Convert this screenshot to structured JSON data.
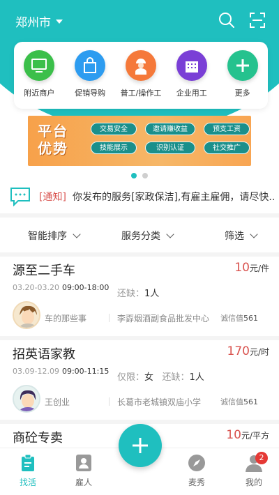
{
  "header": {
    "city": "郑州市",
    "icons": [
      "search-icon",
      "scan-icon"
    ]
  },
  "categories": [
    {
      "label": "附近商户",
      "icon": "monitor-icon",
      "color": "#3bbf4a"
    },
    {
      "label": "促销导购",
      "icon": "shopping-bag-icon",
      "color": "#2d9cf0"
    },
    {
      "label": "普工/操作工",
      "icon": "worker-icon",
      "color": "#f5793a"
    },
    {
      "label": "企业用工",
      "icon": "building-icon",
      "color": "#7a3fd6"
    },
    {
      "label": "更多",
      "icon": "plus-icon",
      "color": "#25c28e"
    }
  ],
  "banner": {
    "title_line1": "平台",
    "title_line2": "优势",
    "tags": [
      "交易安全",
      "邀请赚收益",
      "预支工资",
      "技能展示",
      "识别认证",
      "社交推广"
    ]
  },
  "notice": {
    "tag": "[通知]",
    "text": "你发布的服务[家政保洁],有雇主雇佣，请尽快..."
  },
  "filters": {
    "sort": "智能排序",
    "category": "服务分类",
    "filter": "筛选"
  },
  "listings": [
    {
      "title": "源至二手车",
      "price": "10",
      "unit": "元/件",
      "date": "03.20-03.20",
      "time": "09:00-18:00",
      "requirement_label": "",
      "requirement_value": "",
      "need_label": "还缺：",
      "need_value": "1人",
      "user": "车的那些事",
      "company": "李孬烟酒副食品批发中心",
      "credit_label": "诚信值",
      "credit_value": "561"
    },
    {
      "title": "招英语家教",
      "price": "170",
      "unit": "元/时",
      "date": "03.09-12.09",
      "time": "09:00-11:15",
      "requirement_label": "仅限：",
      "requirement_value": "女",
      "need_label": "还缺：",
      "need_value": "1人",
      "user": "王创业",
      "company": "长葛市老城镇双庙小学",
      "credit_label": "诚信值",
      "credit_value": "561"
    },
    {
      "title": "商砼专卖",
      "price": "10",
      "unit": "元/平方"
    }
  ],
  "tabbar": {
    "tabs": [
      {
        "label": "找活",
        "icon": "clipboard-icon",
        "active": true
      },
      {
        "label": "雇人",
        "icon": "id-card-icon",
        "active": false
      },
      {
        "label": "麦秀",
        "icon": "compass-icon",
        "active": false
      },
      {
        "label": "我的",
        "icon": "user-icon",
        "active": false
      }
    ],
    "badge_count": "2"
  },
  "colors": {
    "primary": "#1fbfbf",
    "price": "#d9534f"
  }
}
